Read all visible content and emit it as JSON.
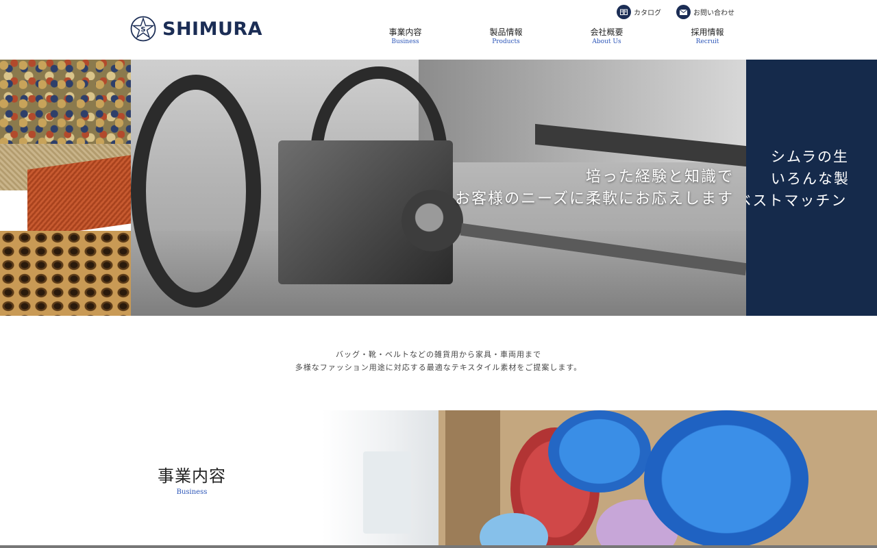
{
  "brand": {
    "name": "SHIMURA",
    "mark_letter": "S",
    "color": "#1b2d55"
  },
  "util_links": [
    {
      "label": "カタログ",
      "icon": "book-icon"
    },
    {
      "label": "お問い合わせ",
      "icon": "mail-icon"
    }
  ],
  "nav": [
    {
      "ja": "事業内容",
      "en": "Business"
    },
    {
      "ja": "製品情報",
      "en": "Products"
    },
    {
      "ja": "会社概要",
      "en": "About Us"
    },
    {
      "ja": "採用情報",
      "en": "Recruit"
    }
  ],
  "hero": {
    "photo_copy": [
      "培った経験と知識で",
      "お客様のニーズに柔軟にお応えします"
    ],
    "panel_copy": [
      "シムラの生",
      "いろんな製",
      "ベストマッチン"
    ],
    "panel_color": "#152a4b"
  },
  "intro": {
    "lines": [
      "バッグ・靴・ベルトなどの雑貨用から家具・車両用まで",
      "多様なファッション用途に対応する最適なテキスタイル素材をご提案します。"
    ]
  },
  "business_section": {
    "title": "事業内容",
    "subtitle": "Business"
  },
  "colors": {
    "accent_link": "#2b55b8",
    "navy": "#1b2d55"
  }
}
